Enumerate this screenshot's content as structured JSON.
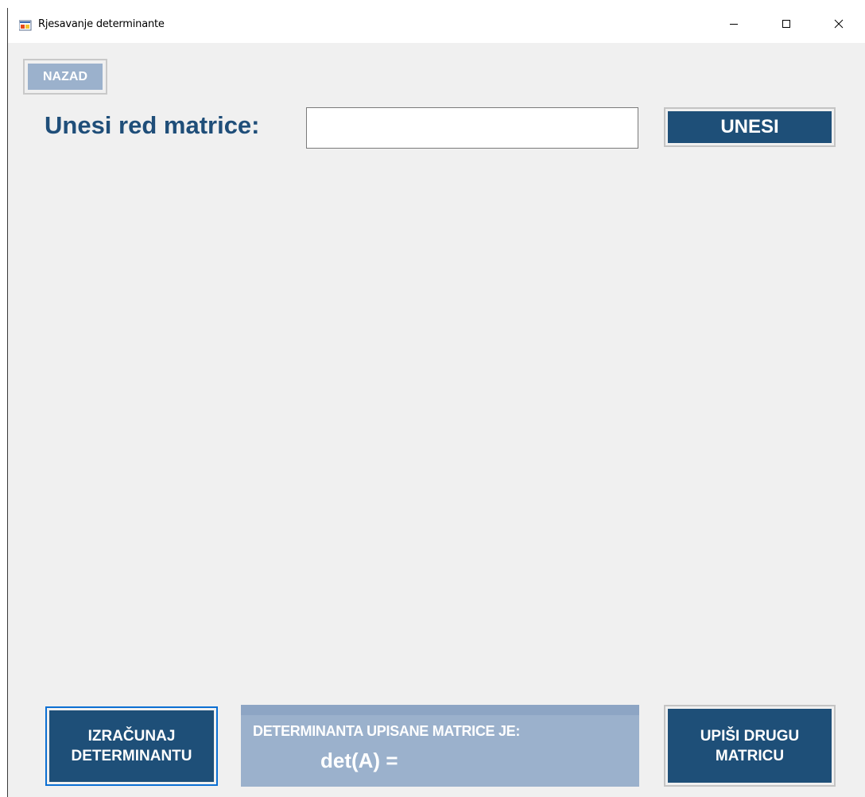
{
  "window": {
    "title": "Rjesavanje determinante",
    "icons": {
      "app": "app-form-icon",
      "minimize": "minimize-icon",
      "maximize": "maximize-icon",
      "close": "close-icon"
    }
  },
  "nav": {
    "back_label": "NAZAD"
  },
  "order_input": {
    "label": "Unesi red matrice:",
    "value": "",
    "placeholder": "",
    "submit_label": "UNESI"
  },
  "actions": {
    "calculate_line1": "IZRAČUNAJ",
    "calculate_line2": "DETERMINANTU",
    "other_line1": "UPIŠI DRUGU",
    "other_line2": "MATRICU"
  },
  "result": {
    "caption": "DETERMINANTA UPISANE MATRICE JE:",
    "det_text": "det(A) ="
  },
  "colors": {
    "primary": "#1e4f78",
    "label": "#1f4e79",
    "muted_button": "#9bb1cc",
    "background": "#f0f0f0"
  }
}
